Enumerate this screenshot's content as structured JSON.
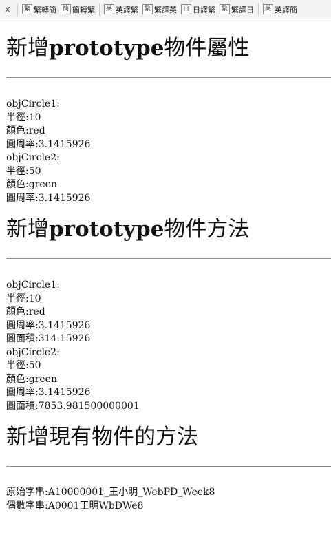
{
  "toolbar": {
    "close_label": "x",
    "buttons": [
      {
        "icon": "繁",
        "label": "繁轉簡"
      },
      {
        "icon": "簡",
        "label": "簡轉繁"
      },
      {
        "icon": "英",
        "label": "英譯繁"
      },
      {
        "icon": "繁",
        "label": "繁譯英"
      },
      {
        "icon": "日",
        "label": "日譯繁"
      },
      {
        "icon": "繁",
        "label": "繁譯日"
      },
      {
        "icon": "英",
        "label": "英譯簡"
      }
    ]
  },
  "sections": [
    {
      "title_prefix": "新增",
      "title_bold": "prototype",
      "title_suffix": "物件屬性",
      "lines": [
        "objCircle1:",
        "半徑:10",
        "顏色:red",
        "圓周率:3.1415926",
        "objCircle2:",
        "半徑:50",
        "顏色:green",
        "圓周率:3.1415926"
      ]
    },
    {
      "title_prefix": "新增",
      "title_bold": "prototype",
      "title_suffix": "物件方法",
      "lines": [
        "objCircle1:",
        "半徑:10",
        "顏色:red",
        "圓周率:3.1415926",
        "圓面積:314.15926",
        "objCircle2:",
        "半徑:50",
        "顏色:green",
        "圓周率:3.1415926",
        "圓面積:7853.981500000001"
      ]
    },
    {
      "title_prefix": "新增現有物件的方法",
      "title_bold": "",
      "title_suffix": "",
      "lines": [
        "原始字串:A10000001_王小明_WebPD_Week8",
        "偶數字串:A0001王明WbDWe8"
      ]
    }
  ]
}
